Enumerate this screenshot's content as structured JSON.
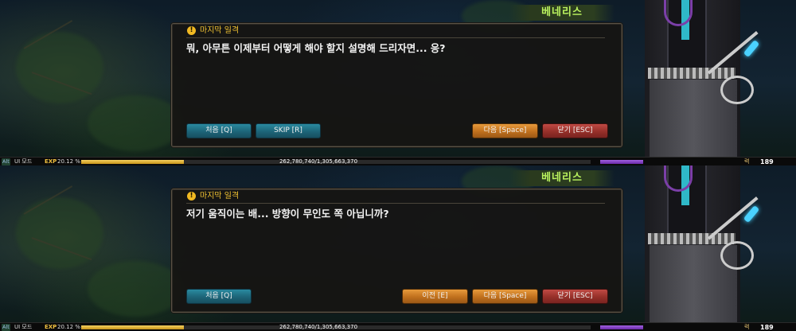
{
  "panels": [
    {
      "speaker": "베네리스",
      "quest_title": "마지막 일격",
      "dialog_text": "뭐, 아무튼 이제부터 어떻게 해야 할지 설명해 드리자면... 응?",
      "buttons": {
        "first": "처음 [Q]",
        "skip": "SKIP [R]",
        "next": "다음 [Space]",
        "close": "닫기 [ESC]"
      }
    },
    {
      "speaker": "베네리스",
      "quest_title": "마지막 일격",
      "dialog_text": "저기 움직이는 배... 방향이 무인도 쪽 아닙니까?",
      "buttons": {
        "first": "처음 [Q]",
        "prev": "이전 [E]",
        "next": "다음 [Space]",
        "close": "닫기 [ESC]"
      }
    }
  ],
  "hud": {
    "alt_label": "Alt",
    "ui_mode": "UI 모드",
    "exp_label": "EXP",
    "exp_percent": "20.12 %",
    "exp_fraction": 0.2012,
    "exp_numbers": "262,780,740/1,305,663,370",
    "right_label": "력",
    "right_value": "189"
  },
  "colors": {
    "speaker_name": "#b9f15e",
    "quest_title": "#f1c232",
    "teal_button": "#1d6478",
    "orange_button": "#c0701d",
    "red_button": "#963029",
    "exp_fill": "#f4d060"
  }
}
